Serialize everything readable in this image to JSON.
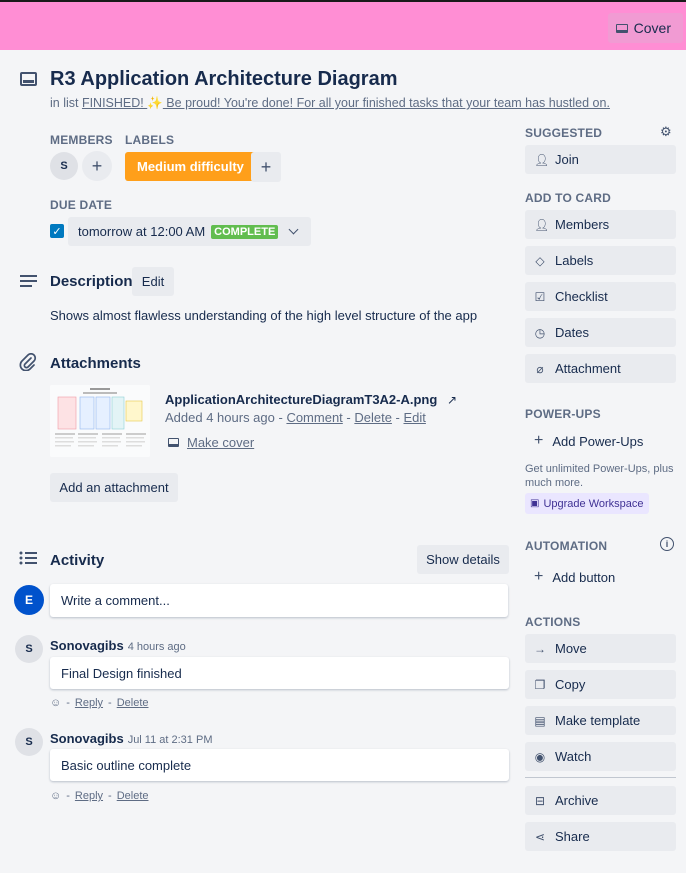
{
  "header": {
    "cover_label": "Cover"
  },
  "card": {
    "title": "R3 Application Architecture Diagram",
    "in_list_prefix": "in list ",
    "list_name": "FINISHED! ",
    "list_tail": " Be proud! You're done! For all your finished tasks that your team has hustled on.",
    "emoji": "✨"
  },
  "members": {
    "label": "MEMBERS",
    "avatar_initial": "S"
  },
  "labels": {
    "label": "LABELS",
    "items": [
      "Medium difficulty"
    ],
    "color": "#ff9f1a"
  },
  "due": {
    "label": "DUE DATE",
    "value": "tomorrow at 12:00 AM",
    "status": "COMPLETE",
    "checked": true
  },
  "description": {
    "heading": "Description",
    "edit_label": "Edit",
    "text": "Shows almost flawless understanding of the high level structure of the app"
  },
  "attachments": {
    "heading": "Attachments",
    "file_name": "ApplicationArchitectureDiagramT3A2-A.png",
    "added": "Added 4 hours ago",
    "comment": "Comment",
    "delete": "Delete",
    "edit": "Edit",
    "make_cover": "Make cover",
    "add_label": "Add an attachment"
  },
  "activity": {
    "heading": "Activity",
    "show_details": "Show details",
    "current_user_initial": "E",
    "comment_placeholder": "Write a comment...",
    "entries": [
      {
        "initial": "S",
        "author": "Sonovagibs",
        "time": "4 hours ago",
        "text": "Final Design finished",
        "reply": "Reply",
        "delete": "Delete"
      },
      {
        "initial": "S",
        "author": "Sonovagibs",
        "time": "Jul 11 at 2:31 PM",
        "text": "Basic outline complete",
        "reply": "Reply",
        "delete": "Delete"
      }
    ]
  },
  "sidebar": {
    "suggested_label": "SUGGESTED",
    "join": "Join",
    "add_to_card_label": "ADD TO CARD",
    "add_to_card": [
      "Members",
      "Labels",
      "Checklist",
      "Dates",
      "Attachment"
    ],
    "powerups_label": "POWER-UPS",
    "add_powerups": "Add Power-Ups",
    "powerups_note": "Get unlimited Power-Ups, plus much more.",
    "upgrade": "Upgrade Workspace",
    "automation_label": "AUTOMATION",
    "add_button": "Add button",
    "actions_label": "ACTIONS",
    "actions": [
      "Move",
      "Copy",
      "Make template",
      "Watch",
      "Archive",
      "Share"
    ]
  },
  "colors": {
    "cover": "#ff8ed4",
    "complete": "#61bd4f",
    "avatar_e": "#0052cc"
  }
}
